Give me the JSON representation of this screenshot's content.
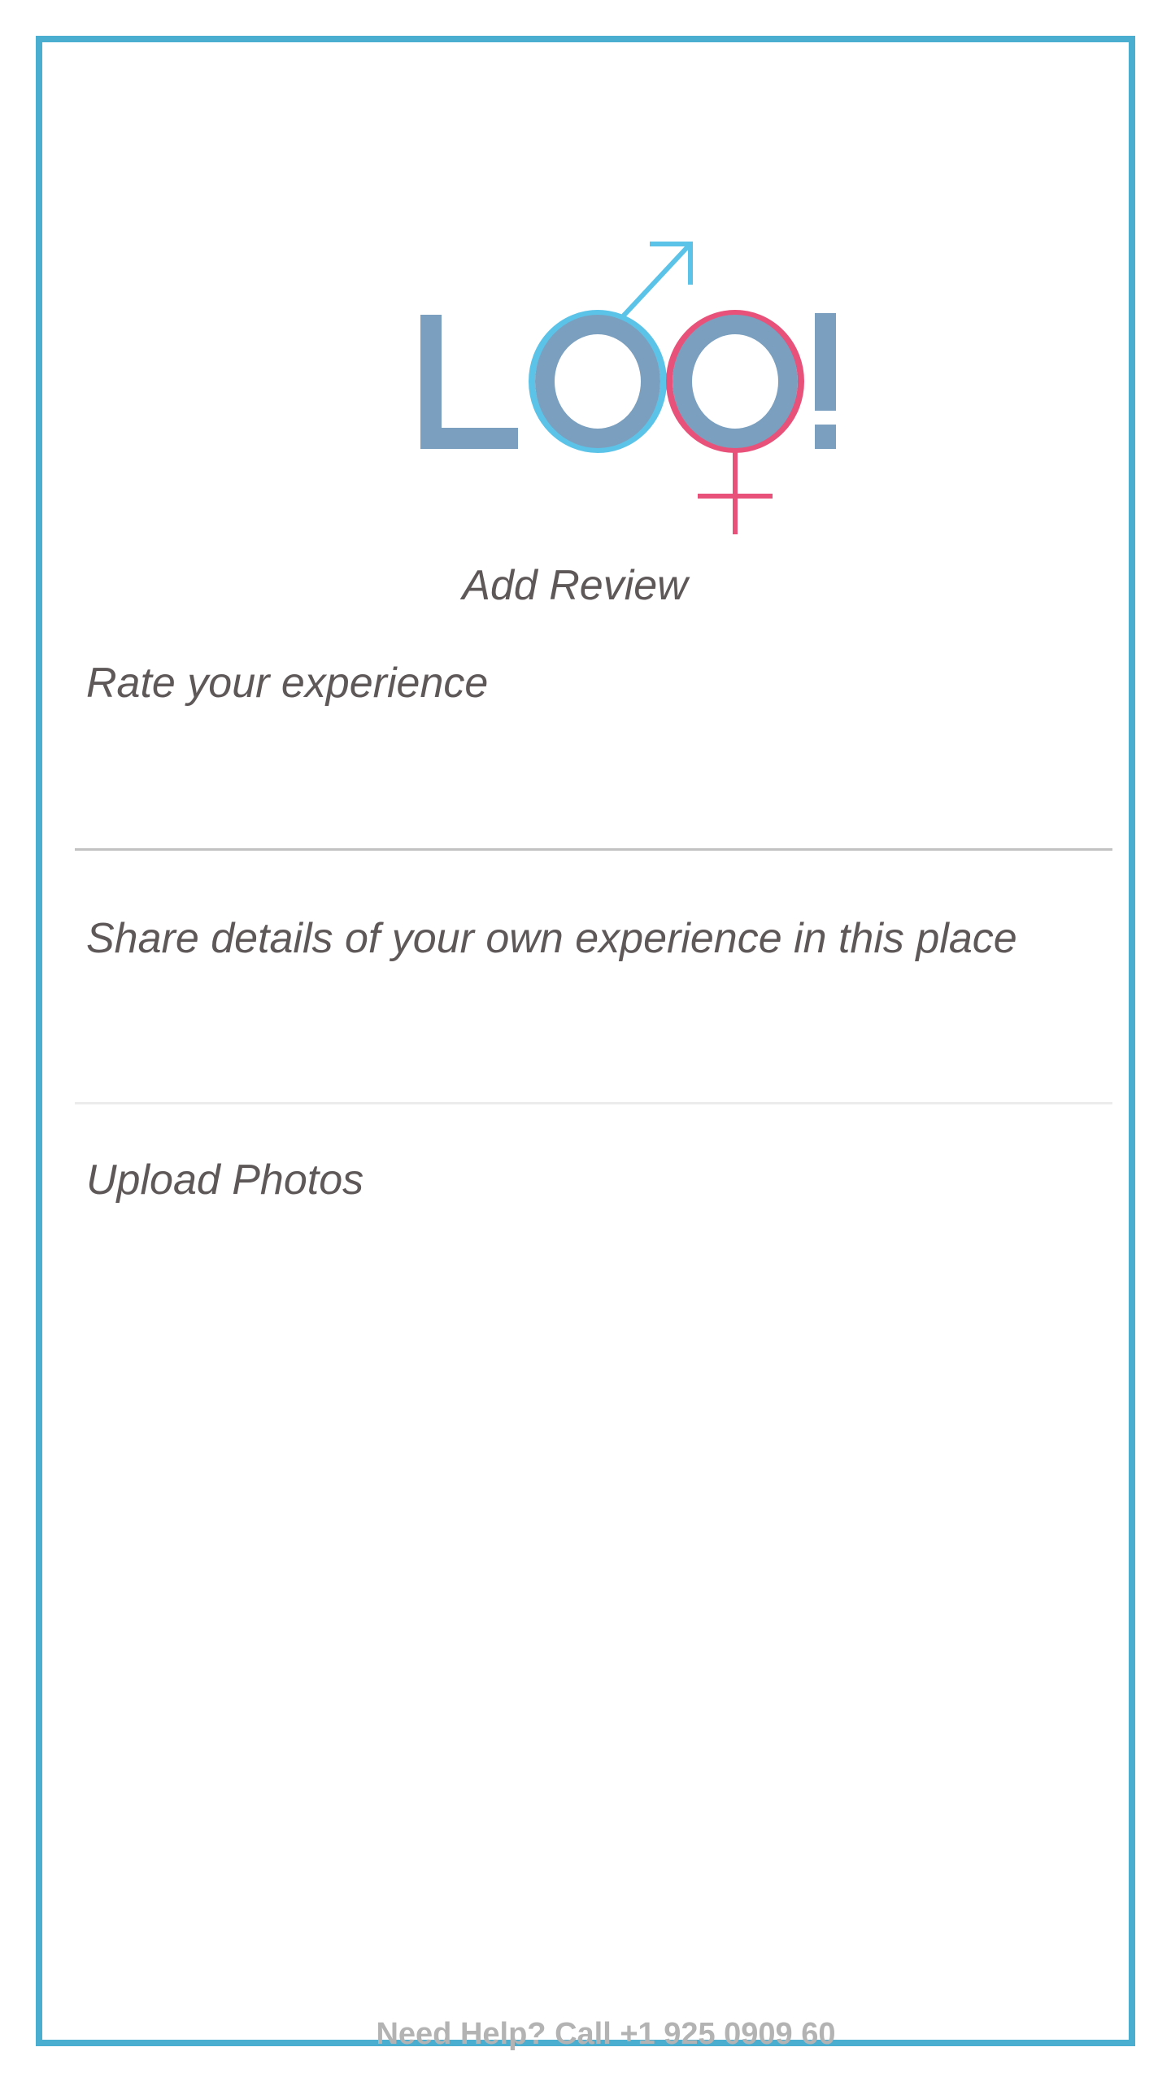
{
  "logo": {
    "name": "LOO!",
    "icon": "loo-gender-logo",
    "colors": {
      "letters": "#7a9fbf",
      "male": "#5cc3e8",
      "female": "#e8527a"
    }
  },
  "screen": {
    "title": "Add Review"
  },
  "form": {
    "rate_label": "Rate your experience",
    "details_label": "Share details of your own experience in this place",
    "upload_label": "Upload Photos"
  },
  "footer": {
    "help_text": "Need Help? Call +1 925 0909 60"
  },
  "colors": {
    "border": "#4aaed1",
    "text": "#5e5859",
    "footer_text": "#b3b3b3",
    "divider": "#c2c2c2"
  }
}
